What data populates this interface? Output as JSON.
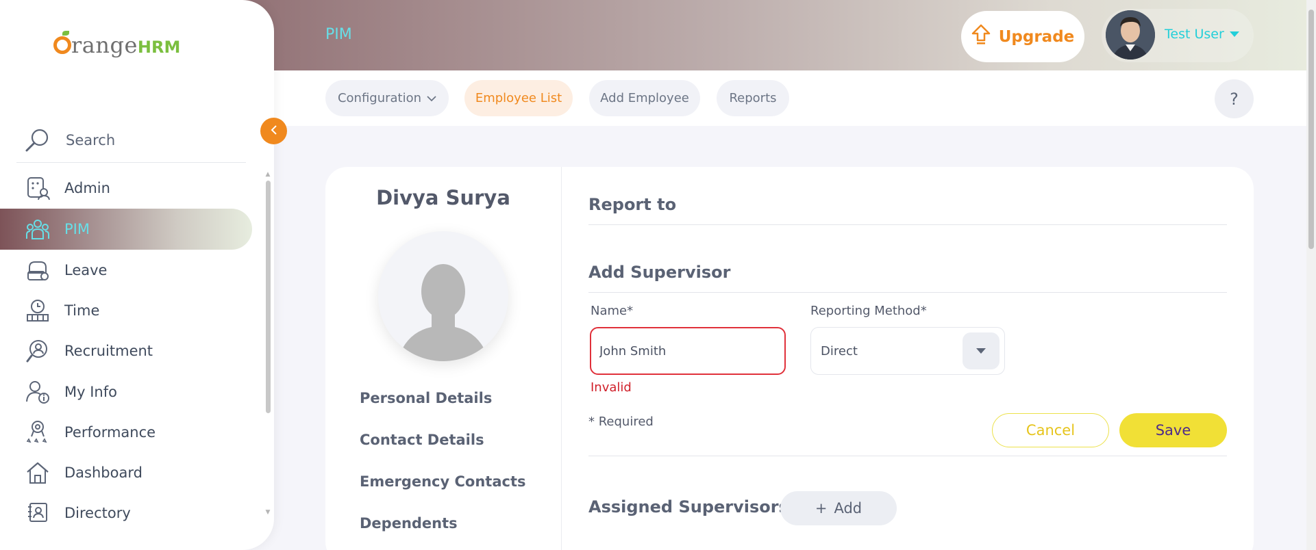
{
  "header": {
    "module_title": "PIM",
    "upgrade_label": "Upgrade",
    "user_name": "Test User"
  },
  "logo": {
    "part1": "range",
    "part2": "HRM"
  },
  "topnav": {
    "configuration": "Configuration",
    "employee_list": "Employee List",
    "add_employee": "Add Employee",
    "reports": "Reports",
    "help": "?"
  },
  "sidebar": {
    "search": "Search",
    "items": [
      {
        "label": "Admin",
        "icon": "admin-icon"
      },
      {
        "label": "PIM",
        "icon": "pim-icon"
      },
      {
        "label": "Leave",
        "icon": "leave-icon"
      },
      {
        "label": "Time",
        "icon": "time-icon"
      },
      {
        "label": "Recruitment",
        "icon": "recruitment-icon"
      },
      {
        "label": "My Info",
        "icon": "my-info-icon"
      },
      {
        "label": "Performance",
        "icon": "performance-icon"
      },
      {
        "label": "Dashboard",
        "icon": "dashboard-icon"
      },
      {
        "label": "Directory",
        "icon": "directory-icon"
      }
    ],
    "active": "PIM"
  },
  "profile": {
    "name": "Divya Surya",
    "links": [
      "Personal Details",
      "Contact Details",
      "Emergency Contacts",
      "Dependents"
    ]
  },
  "report_to": {
    "title": "Report to",
    "add_supervisor_title": "Add Supervisor",
    "name_label": "Name*",
    "name_value": "John Smith",
    "name_error": "Invalid",
    "reporting_method_label": "Reporting Method*",
    "reporting_method_value": "Direct",
    "required_note": "* Required",
    "cancel_label": "Cancel",
    "save_label": "Save",
    "assigned_title": "Assigned Supervisors",
    "add_label": "Add"
  },
  "colors": {
    "brand_orange": "#f0891e",
    "accent_cyan": "#22cfd9",
    "save_yellow": "#f1e036",
    "error_red": "#d0202a"
  }
}
